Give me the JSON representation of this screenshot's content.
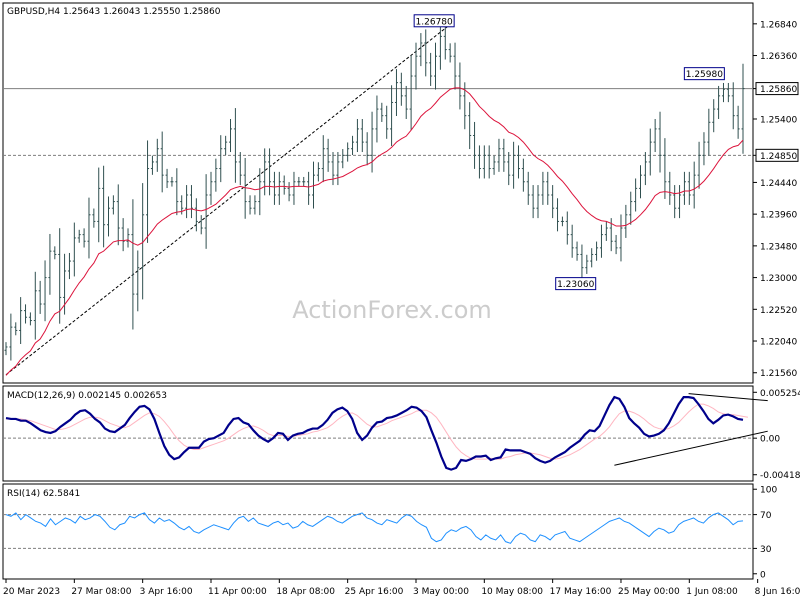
{
  "chart_data": [
    {
      "type": "candlestick",
      "name": "price",
      "title": "GBPUSD,H4  1.25643 1.26043 1.25550 1.25860",
      "watermark": "ActionForex.com",
      "ylim": [
        1.2142,
        1.2714
      ],
      "yticks": [
        "1.26840",
        "1.26360",
        "1.25860",
        "1.25400",
        "1.24850",
        "1.24440",
        "1.23960",
        "1.23480",
        "1.23000",
        "1.22520",
        "1.22040",
        "1.21560"
      ],
      "ytick_values": [
        1.2684,
        1.2636,
        1.2586,
        1.254,
        1.2485,
        1.2444,
        1.2396,
        1.2348,
        1.23,
        1.2252,
        1.2204,
        1.2156
      ],
      "highlight_ticks": [
        "1.25860",
        "1.24850"
      ],
      "levels": [
        {
          "value": 1.2586,
          "style": "solid"
        },
        {
          "value": 1.2485,
          "style": "dashed"
        }
      ],
      "annotations": [
        {
          "text": "1.26780",
          "x": 91,
          "y": 1.2678
        },
        {
          "text": "1.23060",
          "x": 120,
          "y": 1.2306
        },
        {
          "text": "1.25980",
          "x": 148,
          "y": 1.2598
        }
      ],
      "close": [
        1.2195,
        1.2225,
        1.222,
        1.225,
        1.224,
        1.2235,
        1.228,
        1.226,
        1.23,
        1.234,
        1.2335,
        1.227,
        1.231,
        1.2325,
        1.236,
        1.2365,
        1.2355,
        1.2395,
        1.2385,
        1.2435,
        1.238,
        1.2405,
        1.2415,
        1.2375,
        1.2355,
        1.2365,
        1.2275,
        1.2315,
        1.2395,
        1.2465,
        1.2475,
        1.2495,
        1.2455,
        1.2445,
        1.2445,
        1.2415,
        1.2405,
        1.2425,
        1.2405,
        1.2385,
        1.2375,
        1.2425,
        1.2445,
        1.2465,
        1.2495,
        1.2505,
        1.2525,
        1.2475,
        1.2455,
        1.2415,
        1.2405,
        1.2415,
        1.2445,
        1.2475,
        1.2445,
        1.2425,
        1.2445,
        1.2435,
        1.2425,
        1.2445,
        1.2445,
        1.2445,
        1.2425,
        1.2455,
        1.2465,
        1.2495,
        1.2475,
        1.2455,
        1.2475,
        1.2485,
        1.2495,
        1.2505,
        1.2525,
        1.2505,
        1.2485,
        1.2525,
        1.2555,
        1.2545,
        1.2525,
        1.2565,
        1.2595,
        1.2575,
        1.2555,
        1.2605,
        1.2635,
        1.2655,
        1.2625,
        1.2605,
        1.2635,
        1.2665,
        1.2645,
        1.2635,
        1.2605,
        1.2575,
        1.2545,
        1.2515,
        1.2485,
        1.2465,
        1.2485,
        1.2465,
        1.2475,
        1.2495,
        1.2475,
        1.2455,
        1.2485,
        1.2465,
        1.2445,
        1.2425,
        1.2405,
        1.2425,
        1.2445,
        1.2425,
        1.2405,
        1.2385,
        1.2385,
        1.2365,
        1.2345,
        1.2335,
        1.2315,
        1.2325,
        1.2335,
        1.2345,
        1.2365,
        1.2375,
        1.2355,
        1.2345,
        1.2375,
        1.2395,
        1.2415,
        1.2435,
        1.2455,
        1.2475,
        1.2505,
        1.2525,
        1.2485,
        1.2445,
        1.2425,
        1.2405,
        1.2425,
        1.2445,
        1.2425,
        1.2455,
        1.2485,
        1.2505,
        1.2535,
        1.2555,
        1.2575,
        1.2585,
        1.2575,
        1.2545,
        1.2525,
        1.2586
      ],
      "ma": [
        1.2152,
        1.216,
        1.2166,
        1.2176,
        1.2183,
        1.2189,
        1.2201,
        1.2207,
        1.2219,
        1.2234,
        1.2245,
        1.2249,
        1.2259,
        1.2269,
        1.2281,
        1.2292,
        1.2301,
        1.2313,
        1.2322,
        1.2336,
        1.234,
        1.2347,
        1.2354,
        1.2356,
        1.2356,
        1.2357,
        1.2352,
        1.2349,
        1.2353,
        1.2362,
        1.2371,
        1.2381,
        1.2387,
        1.2392,
        1.2397,
        1.2399,
        1.24,
        1.2403,
        1.2404,
        1.2402,
        1.2401,
        1.2403,
        1.2407,
        1.2411,
        1.2418,
        1.2425,
        1.2433,
        1.2436,
        1.2438,
        1.2436,
        1.2435,
        1.2433,
        1.2434,
        1.2438,
        1.2438,
        1.2437,
        1.2438,
        1.2438,
        1.2437,
        1.2438,
        1.2438,
        1.2438,
        1.2437,
        1.2439,
        1.2441,
        1.2446,
        1.2448,
        1.2449,
        1.2451,
        1.2453,
        1.2457,
        1.2461,
        1.2466,
        1.2469,
        1.2471,
        1.2475,
        1.2482,
        1.2487,
        1.2491,
        1.2497,
        1.2505,
        1.251,
        1.2514,
        1.2523,
        1.2533,
        1.2544,
        1.2551,
        1.2556,
        1.2564,
        1.2573,
        1.2579,
        1.2585,
        1.2587,
        1.2587,
        1.2584,
        1.2578,
        1.2569,
        1.2559,
        1.2552,
        1.2544,
        1.2538,
        1.2534,
        1.2528,
        1.252,
        1.2517,
        1.2512,
        1.2505,
        1.2496,
        1.2486,
        1.248,
        1.2476,
        1.247,
        1.2462,
        1.2453,
        1.2446,
        1.2437,
        1.2427,
        1.2418,
        1.2408,
        1.24,
        1.2394,
        1.2389,
        1.2386,
        1.2385,
        1.2382,
        1.2378,
        1.2378,
        1.2379,
        1.2383,
        1.2388,
        1.2395,
        1.2403,
        1.2413,
        1.2424,
        1.2429,
        1.243,
        1.2429,
        1.2427,
        1.2428,
        1.2431,
        1.2431,
        1.2434,
        1.2439,
        1.2446,
        1.2455,
        1.2465,
        1.2476,
        1.2486,
        1.2494,
        1.2498,
        1.25,
        1.2508
      ],
      "trendline": {
        "from": [
          0,
          1.2153
        ],
        "to": [
          91,
          1.2683
        ]
      },
      "colors": {
        "candle": "#2f4f4f",
        "ma": "#dc143c",
        "grid": "#7f7f7f"
      }
    },
    {
      "type": "line",
      "name": "MACD",
      "title": "MACD(12,26,9) 0.002145 0.002653",
      "ylim": [
        -0.00479,
        0.00586
      ],
      "yticks": [
        "0.005254",
        "0.00",
        "-0.004185"
      ],
      "ytick_values": [
        0.005254,
        0.0,
        -0.004185
      ],
      "macd": [
        0.0023,
        0.0022,
        0.0022,
        0.002,
        0.002,
        0.0017,
        0.0013,
        0.0009,
        0.0007,
        0.0006,
        0.0008,
        0.0013,
        0.0017,
        0.0021,
        0.0027,
        0.0031,
        0.0032,
        0.0028,
        0.0022,
        0.0018,
        0.0011,
        0.0008,
        0.0007,
        0.0011,
        0.0015,
        0.0023,
        0.003,
        0.0036,
        0.0037,
        0.0033,
        0.0022,
        0.0006,
        -0.0009,
        -0.0019,
        -0.0024,
        -0.0022,
        -0.0016,
        -0.0011,
        -0.0011,
        -0.0011,
        -0.0004,
        -0.0001,
        0.0,
        0.0003,
        0.0006,
        0.0015,
        0.0022,
        0.0023,
        0.0018,
        0.0016,
        0.0009,
        0.0003,
        -0.0001,
        -0.0004,
        0.0,
        0.0006,
        0.0005,
        -0.0002,
        0.0003,
        0.0005,
        0.0006,
        0.0009,
        0.0011,
        0.0011,
        0.0015,
        0.0021,
        0.0029,
        0.0033,
        0.0035,
        0.0031,
        0.0022,
        0.0006,
        -0.0002,
        0.0003,
        0.0012,
        0.0018,
        0.0019,
        0.0023,
        0.0024,
        0.0026,
        0.0029,
        0.0032,
        0.0036,
        0.0035,
        0.0031,
        0.0024,
        0.0009,
        -0.0005,
        -0.0021,
        -0.0034,
        -0.0036,
        -0.0034,
        -0.0025,
        -0.0026,
        -0.0024,
        -0.0021,
        -0.0021,
        -0.002,
        -0.0025,
        -0.0023,
        -0.0022,
        -0.0013,
        -0.0014,
        -0.0014,
        -0.0014,
        -0.0016,
        -0.0018,
        -0.0023,
        -0.0026,
        -0.0028,
        -0.0026,
        -0.0022,
        -0.0019,
        -0.0016,
        -0.0011,
        -0.0007,
        -0.0003,
        0.0004,
        0.0009,
        0.0008,
        0.0014,
        0.0026,
        0.0038,
        0.0047,
        0.0045,
        0.0036,
        0.0023,
        0.0017,
        0.0012,
        0.0005,
        0.0002,
        0.0003,
        0.0005,
        0.0009,
        0.0017,
        0.0028,
        0.0039,
        0.0047,
        0.0047,
        0.0046,
        0.0039,
        0.0031,
        0.0022,
        0.0017,
        0.0021,
        0.0026,
        0.0027,
        0.0025,
        0.0022,
        0.0021
      ],
      "signal": [
        0.0022,
        0.0022,
        0.0022,
        0.0022,
        0.0021,
        0.002,
        0.0018,
        0.0016,
        0.0014,
        0.0012,
        0.001,
        0.001,
        0.0011,
        0.0013,
        0.0016,
        0.0019,
        0.0022,
        0.0024,
        0.0024,
        0.0023,
        0.002,
        0.0017,
        0.0015,
        0.0013,
        0.0012,
        0.0014,
        0.0018,
        0.0022,
        0.0026,
        0.0029,
        0.0028,
        0.0025,
        0.0019,
        0.0012,
        0.0004,
        -0.0003,
        -0.0008,
        -0.0011,
        -0.0013,
        -0.0013,
        -0.0011,
        -0.0009,
        -0.0007,
        -0.0005,
        -0.0003,
        0.0,
        0.0004,
        0.0008,
        0.0011,
        0.0013,
        0.0014,
        0.0012,
        0.0009,
        0.0005,
        0.0003,
        0.0003,
        0.0003,
        0.0002,
        0.0002,
        0.0003,
        0.0004,
        0.0005,
        0.0007,
        0.0008,
        0.001,
        0.0012,
        0.0016,
        0.0021,
        0.0025,
        0.0028,
        0.0029,
        0.0026,
        0.0021,
        0.0016,
        0.0013,
        0.0013,
        0.0015,
        0.0017,
        0.002,
        0.0022,
        0.0024,
        0.0026,
        0.0028,
        0.0031,
        0.0032,
        0.0032,
        0.0029,
        0.0024,
        0.0016,
        0.0007,
        -0.0002,
        -0.001,
        -0.0016,
        -0.002,
        -0.0023,
        -0.0024,
        -0.0024,
        -0.0024,
        -0.0023,
        -0.0024,
        -0.0024,
        -0.0022,
        -0.0021,
        -0.0019,
        -0.0018,
        -0.0017,
        -0.0017,
        -0.0018,
        -0.0019,
        -0.0021,
        -0.0023,
        -0.0024,
        -0.0023,
        -0.0021,
        -0.0019,
        -0.0016,
        -0.0013,
        -0.0009,
        -0.0005,
        -0.0001,
        0.0002,
        0.0007,
        0.0013,
        0.0021,
        0.0028,
        0.0031,
        0.0031,
        0.0029,
        0.0026,
        0.0022,
        0.0017,
        0.0013,
        0.0011,
        0.001,
        0.0011,
        0.0014,
        0.0018,
        0.0024,
        0.003,
        0.0035,
        0.0039,
        0.0039,
        0.0037,
        0.0034,
        0.003,
        0.0028,
        0.0027,
        0.0027,
        0.0026,
        0.0025,
        0.0024
      ],
      "trendlines": [
        {
          "from": [
            123,
            -0.0031
          ],
          "to": [
            154,
            0.0008
          ]
        },
        {
          "from": [
            138,
            0.0051
          ],
          "to": [
            154,
            0.0043
          ]
        }
      ],
      "colors": {
        "macd": "#00008b",
        "signal": "#ffb6c1",
        "zero": "#7f7f7f"
      }
    },
    {
      "type": "line",
      "name": "RSI",
      "title": "RSI(14) 62.5841",
      "ylim": [
        -5,
        105
      ],
      "yticks": [
        "100",
        "70",
        "30",
        "0"
      ],
      "ytick_values": [
        100,
        70,
        30,
        0
      ],
      "levels": [
        70,
        30
      ],
      "rsi": [
        70,
        68,
        72,
        64,
        70,
        66,
        62,
        60,
        56,
        65,
        58,
        62,
        66,
        64,
        60,
        68,
        64,
        66,
        70,
        68,
        62,
        55,
        52,
        58,
        60,
        68,
        66,
        70,
        72,
        64,
        60,
        66,
        62,
        64,
        60,
        55,
        52,
        56,
        50,
        48,
        52,
        55,
        58,
        56,
        54,
        52,
        60,
        66,
        68,
        62,
        66,
        60,
        58,
        56,
        60,
        62,
        58,
        60,
        54,
        56,
        62,
        58,
        56,
        60,
        64,
        68,
        66,
        62,
        60,
        64,
        68,
        70,
        72,
        66,
        64,
        60,
        58,
        64,
        62,
        60,
        66,
        70,
        68,
        62,
        58,
        55,
        42,
        38,
        40,
        48,
        52,
        50,
        54,
        56,
        52,
        44,
        40,
        46,
        42,
        40,
        46,
        38,
        36,
        44,
        48,
        46,
        40,
        38,
        46,
        44,
        40,
        46,
        48,
        50,
        42,
        40,
        38,
        42,
        46,
        50,
        54,
        58,
        62,
        64,
        66,
        62,
        60,
        56,
        52,
        48,
        44,
        50,
        54,
        52,
        48,
        50,
        58,
        62,
        64,
        66,
        62,
        60,
        66,
        70,
        72,
        68,
        64,
        58,
        62,
        62.58
      ],
      "colors": {
        "rsi": "#1e90ff",
        "level": "#7f7f7f"
      }
    }
  ],
  "xaxis": {
    "labels": [
      "20 Mar 2023",
      "27 Mar 08:00",
      "3 Apr 16:00",
      "11 Apr 00:00",
      "18 Apr 08:00",
      "25 Apr 16:00",
      "3 May 00:00",
      "10 May 08:00",
      "17 May 16:00",
      "25 May 00:00",
      "1 Jun 08:00",
      "8 Jun 16:00"
    ],
    "label_bars": [
      0,
      14,
      28,
      42,
      56,
      70,
      84,
      98,
      112,
      126,
      140,
      154
    ]
  }
}
